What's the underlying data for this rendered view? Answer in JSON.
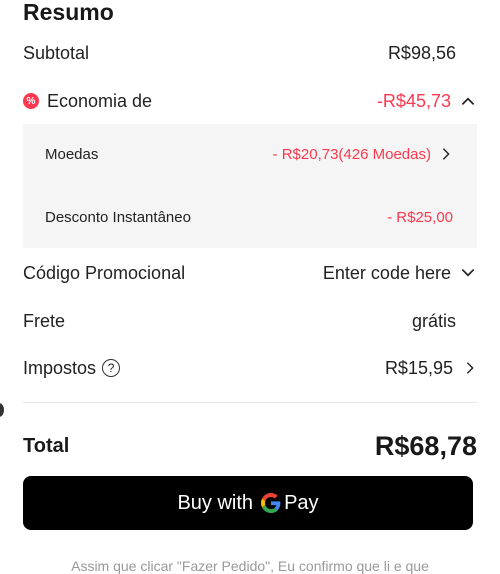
{
  "summary": {
    "title": "Resumo",
    "subtotal": {
      "label": "Subtotal",
      "value": "R$98,56"
    },
    "savings": {
      "label": "Economia de",
      "value": "-R$45,73",
      "icon": "discount-icon",
      "expanded": true
    },
    "savings_details": [
      {
        "label": "Moedas",
        "value": "- R$20,73(426 Moedas)",
        "has_arrow": true
      },
      {
        "label": "Desconto Instantâneo",
        "value": "- R$25,00",
        "has_arrow": false
      }
    ],
    "promo": {
      "label": "Código Promocional",
      "placeholder": "Enter code here"
    },
    "shipping": {
      "label": "Frete",
      "value": "grátis"
    },
    "taxes": {
      "label": "Impostos",
      "value": "R$15,95",
      "help_icon": "?"
    },
    "total": {
      "label": "Total",
      "value": "R$68,78"
    },
    "pay_button": {
      "prefix": "Buy with",
      "suffix": "Pay"
    },
    "footnote": "Assim que clicar \"Fazer Pedido\", Eu confirmo que li e que"
  },
  "colors": {
    "accent_red": "#fd384f",
    "button_bg": "#000000",
    "panel_bg": "#f5f5f5"
  }
}
